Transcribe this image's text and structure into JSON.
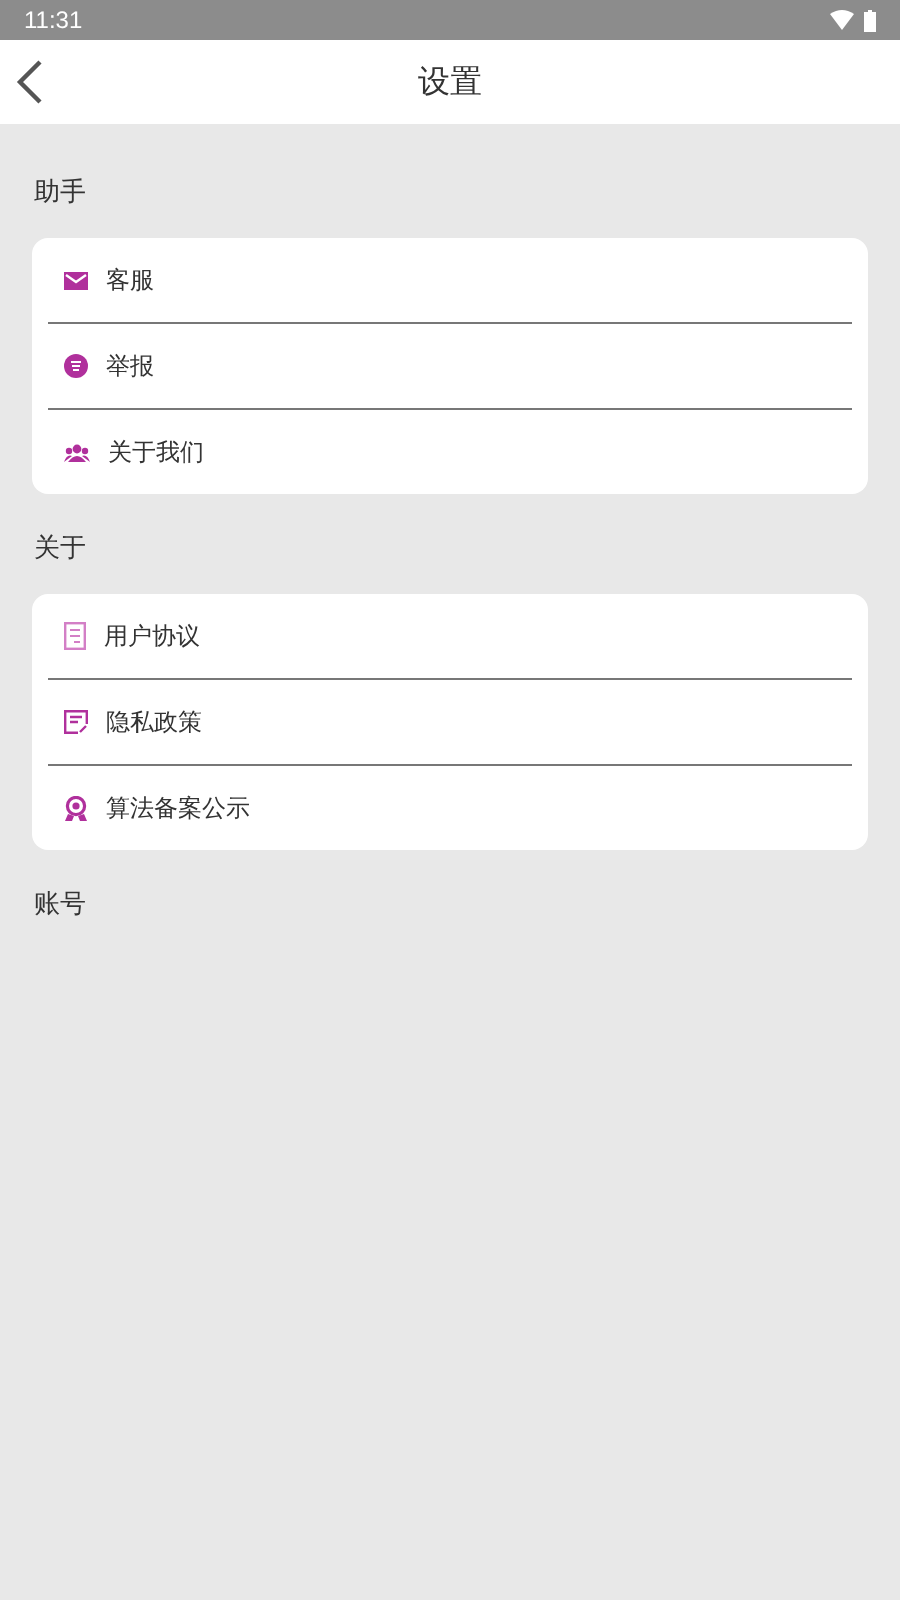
{
  "status_bar": {
    "time": "11:31"
  },
  "header": {
    "title": "设置"
  },
  "sections": [
    {
      "title": "助手",
      "items": [
        {
          "label": "客服"
        },
        {
          "label": "举报"
        },
        {
          "label": "关于我们"
        }
      ]
    },
    {
      "title": "关于",
      "items": [
        {
          "label": "用户协议"
        },
        {
          "label": "隐私政策"
        },
        {
          "label": "算法备案公示"
        }
      ]
    },
    {
      "title": "账号"
    }
  ]
}
